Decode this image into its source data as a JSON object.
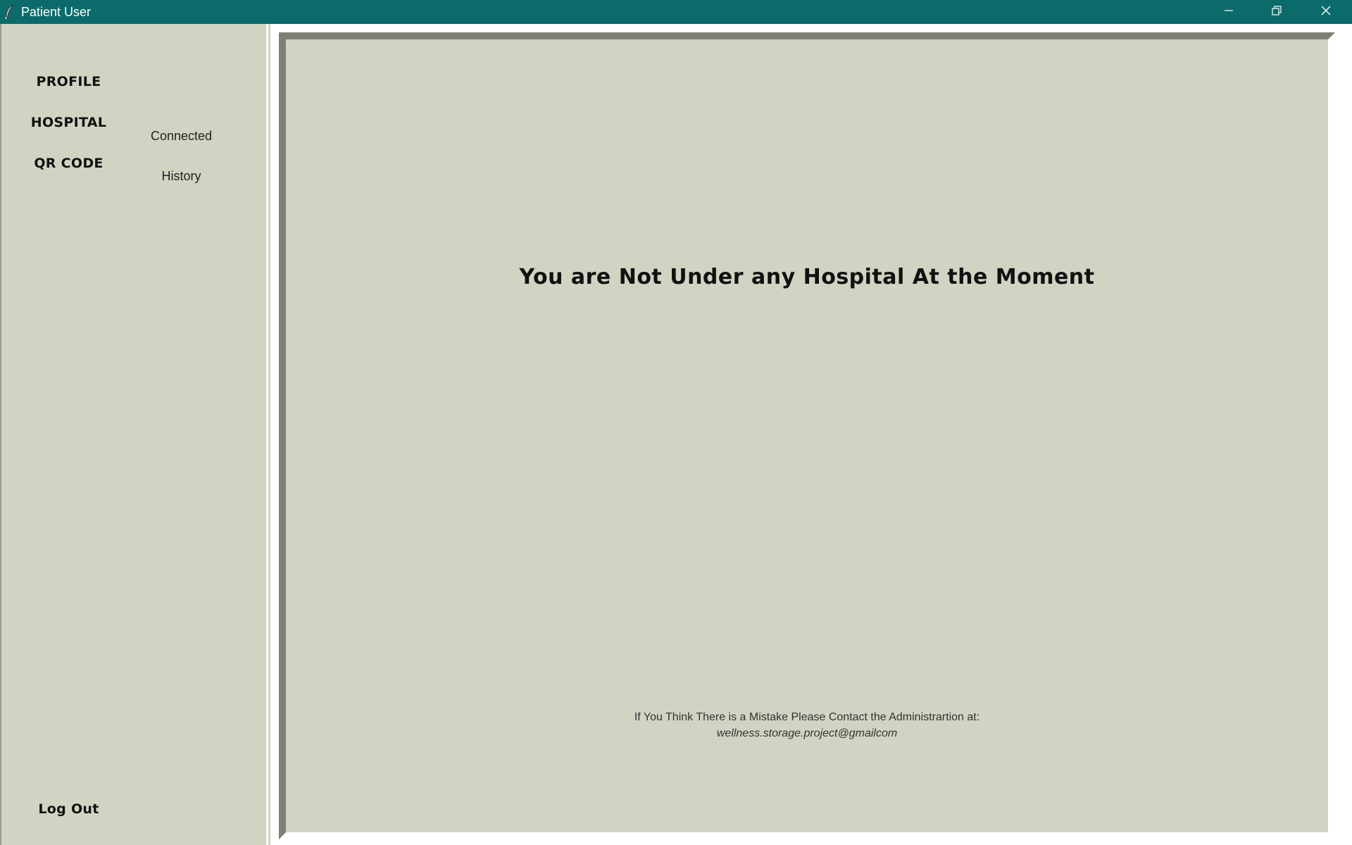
{
  "window": {
    "title": "Patient User",
    "icons": {
      "app": "feather-icon",
      "minimize": "minimize-icon",
      "maximize": "restore-icon",
      "close": "close-icon"
    }
  },
  "sidebar": {
    "nav": [
      {
        "label": "PROFILE"
      },
      {
        "label": "HOSPITAL"
      },
      {
        "label": "QR CODE"
      }
    ],
    "sub_nav": [
      {
        "label": "Connected"
      },
      {
        "label": "History"
      }
    ],
    "logout_label": "Log Out"
  },
  "main": {
    "message": "You are Not Under any Hospital At the Moment",
    "contact_text": "If You Think There is a Mistake Please Contact the Administrartion at:",
    "contact_email": "wellness.storage.project@gmailcom"
  },
  "colors": {
    "titlebar": "#0b6b6b",
    "background": "#d3d3c3",
    "panel_border_dark": "#7f7f74"
  }
}
